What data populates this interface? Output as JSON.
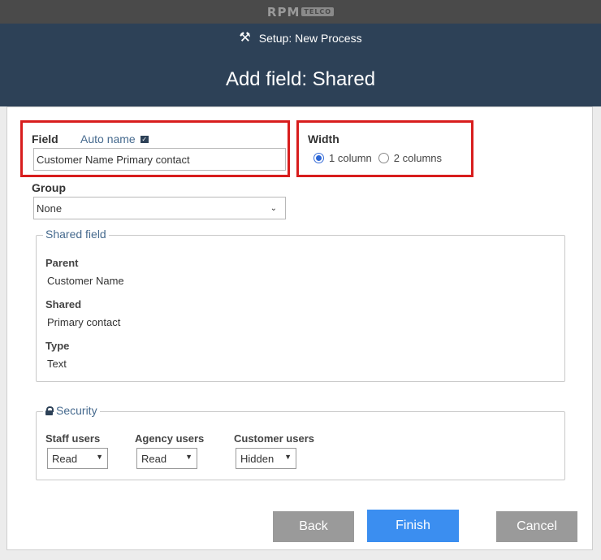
{
  "brand": {
    "name": "RPM",
    "tag": "TELCO"
  },
  "header": {
    "breadcrumb": "Setup: New Process",
    "title": "Add field: Shared",
    "breadcrumb_icon": "tools-icon"
  },
  "field": {
    "label": "Field",
    "auto_name_label": "Auto name",
    "auto_name_checked": true,
    "value": "Customer Name Primary contact"
  },
  "width": {
    "label": "Width",
    "options": [
      "1 column",
      "2 columns"
    ],
    "selected": "1 column"
  },
  "group": {
    "label": "Group",
    "value": "None"
  },
  "shared_field": {
    "legend": "Shared field",
    "parent_label": "Parent",
    "parent_value": "Customer Name",
    "shared_label": "Shared",
    "shared_value": "Primary contact",
    "type_label": "Type",
    "type_value": "Text"
  },
  "security": {
    "legend": "Security",
    "staff_label": "Staff users",
    "staff_value": "Read",
    "agency_label": "Agency users",
    "agency_value": "Read",
    "customer_label": "Customer users",
    "customer_value": "Hidden"
  },
  "buttons": {
    "back": "Back",
    "finish": "Finish",
    "cancel": "Cancel"
  },
  "colors": {
    "header_bg": "#2d4157",
    "highlight": "#d81d1d",
    "primary_button": "#3b8ef0",
    "secondary_button": "#9a9a9a",
    "link": "#466a8e"
  }
}
